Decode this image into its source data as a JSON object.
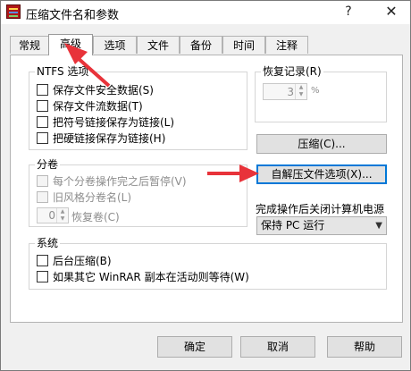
{
  "window": {
    "title": "压缩文件名和参数",
    "help_glyph": "?",
    "close_glyph": "✕"
  },
  "tabs": [
    {
      "label": "常规"
    },
    {
      "label": "高级"
    },
    {
      "label": "选项"
    },
    {
      "label": "文件"
    },
    {
      "label": "备份"
    },
    {
      "label": "时间"
    },
    {
      "label": "注释"
    }
  ],
  "active_tab": "高级",
  "ntfs": {
    "title": "NTFS 选项",
    "options": [
      {
        "label": "保存文件安全数据(S)",
        "checked": false
      },
      {
        "label": "保存文件流数据(T)",
        "checked": false
      },
      {
        "label": "把符号链接保存为链接(L)",
        "checked": false
      },
      {
        "label": "把硬链接保存为链接(H)",
        "checked": false
      }
    ]
  },
  "recovery": {
    "title": "恢复记录(R)",
    "value": "3",
    "unit": "%"
  },
  "compress_button": "压缩(C)...",
  "volumes": {
    "title": "分卷",
    "pause_label": "每个分卷操作完之后暂停(V)",
    "oldstyle_label": "旧风格分卷名(L)",
    "recovery_value": "0",
    "recovery_label": "恢复卷(C)"
  },
  "sfx_button": "自解压文件选项(X)...",
  "after_done": {
    "label": "完成操作后关闭计算机电源",
    "selected": "保持 PC 运行"
  },
  "system": {
    "title": "系统",
    "options": [
      {
        "label": "后台压缩(B)",
        "checked": false
      },
      {
        "label": "如果其它 WinRAR 副本在活动则等待(W)",
        "checked": false
      }
    ]
  },
  "footer": {
    "ok": "确定",
    "cancel": "取消",
    "help": "帮助"
  },
  "colors": {
    "annotation_arrow": "#e8333a",
    "focus": "#0078d7"
  }
}
